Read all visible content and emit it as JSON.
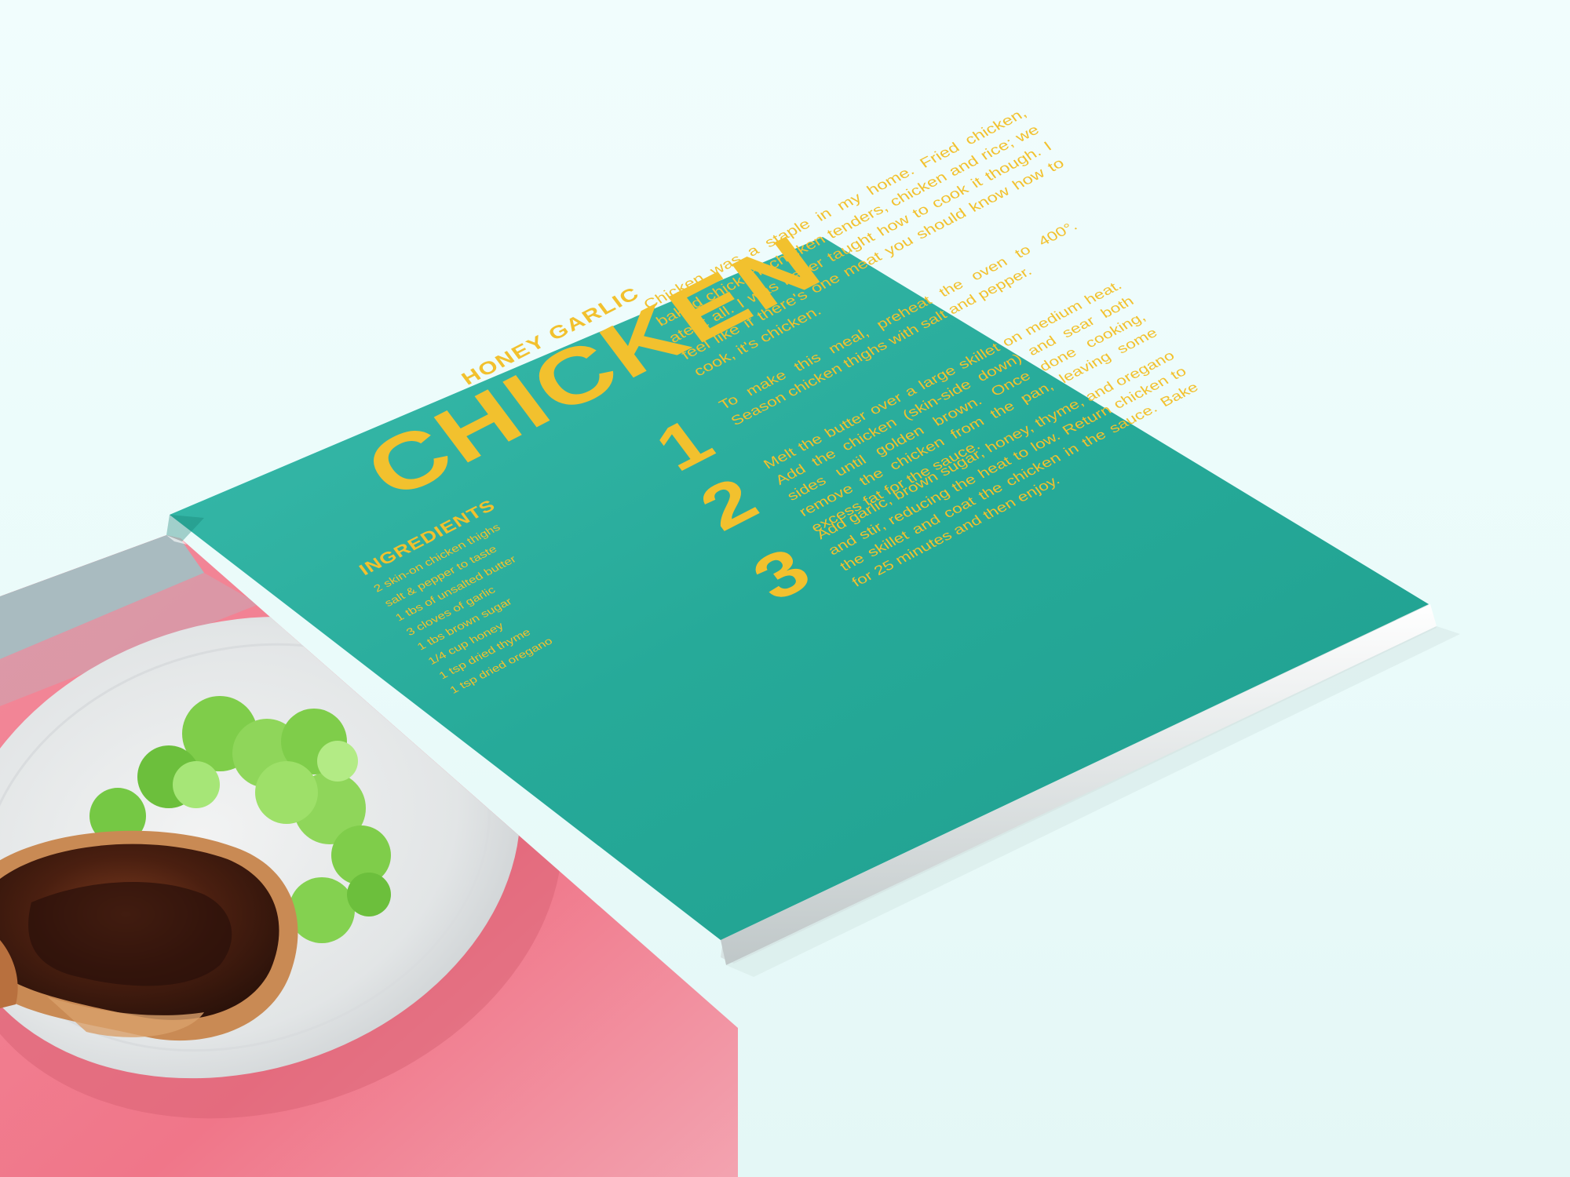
{
  "colors": {
    "background": "#eefcfb",
    "page_teal": "#27ab9a",
    "accent_yellow": "#f2c12e",
    "photo_pink": "#f17e8f",
    "photo_top_band": "#9fbcc0"
  },
  "recipe": {
    "subtitle": "HONEY GARLIC",
    "title": "CHICKEN",
    "ingredients_heading": "INGREDIENTS",
    "ingredients": [
      "2 skin-on chicken thighs",
      "salt & pepper to taste",
      "1 tbs of unsalted butter",
      "3 cloves of garlic",
      "1 tbs brown sugar",
      "1/4 cup honey",
      "1 tsp dried thyme",
      "1 tsp dried oregano"
    ],
    "intro": "Chicken was a staple in my home. Fried chicken, baked chicken, chicken tenders, chicken and rice; we ate it all. I was never taught how to cook it though. I feel like if there's one meat you should know how to cook, it's chicken.",
    "steps": [
      {
        "number": "1",
        "text": "To make this meal, preheat the oven to 400°. Season chicken thighs with salt and pepper."
      },
      {
        "number": "2",
        "text": "Melt the butter over a large skillet on medium heat. Add the chicken (skin-side down) and sear both sides until golden brown. Once done cooking, remove the chicken from the pan, leaving some excess fat for the sauce."
      },
      {
        "number": "3",
        "text": "Add garlic, brown sugar, honey, thyme, and oregano and stir, reducing the heat to low. Return chicken to the skillet and coat the chicken in the sauce. Bake for 25 minutes and then enjoy."
      }
    ]
  }
}
